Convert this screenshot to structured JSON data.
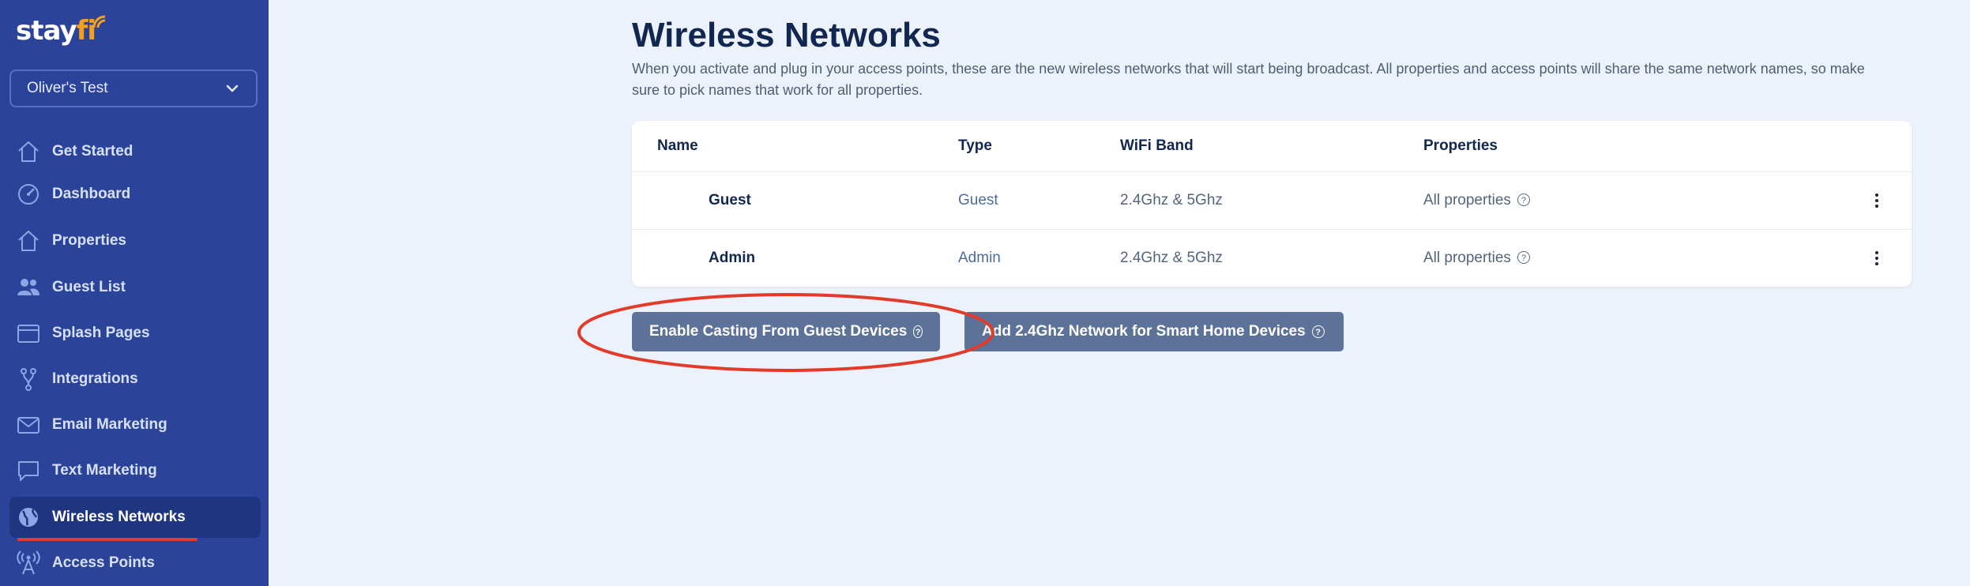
{
  "app": {
    "logo_text": "stay",
    "logo_accent": "fi"
  },
  "account": {
    "name": "Oliver's Test"
  },
  "sidebar": {
    "items": [
      {
        "label": "Get Started",
        "icon": "home-icon"
      },
      {
        "label": "Dashboard",
        "icon": "gauge-icon"
      },
      {
        "label": "Properties",
        "icon": "house-icon"
      },
      {
        "label": "Guest List",
        "icon": "users-icon"
      },
      {
        "label": "Splash Pages",
        "icon": "browser-window-icon"
      },
      {
        "label": "Integrations",
        "icon": "fork-icon"
      },
      {
        "label": "Email Marketing",
        "icon": "envelope-icon"
      },
      {
        "label": "Text Marketing",
        "icon": "chat-bubble-icon"
      },
      {
        "label": "Wireless Networks",
        "icon": "globe-icon",
        "active": true
      },
      {
        "label": "Access Points",
        "icon": "antenna-icon"
      }
    ]
  },
  "page": {
    "title": "Wireless Networks",
    "description": "When you activate and plug in your access points, these are the new wireless networks that will start being broadcast. All properties and access points will share the same network names, so make sure to pick names that work for all properties."
  },
  "table": {
    "headers": {
      "name": "Name",
      "type": "Type",
      "band": "WiFi Band",
      "properties": "Properties"
    },
    "rows": [
      {
        "name": "Guest",
        "type": "Guest",
        "band": "2.4Ghz & 5Ghz",
        "properties": "All properties"
      },
      {
        "name": "Admin",
        "type": "Admin",
        "band": "2.4Ghz & 5Ghz",
        "properties": "All properties"
      }
    ]
  },
  "actions": {
    "enable_casting": "Enable Casting From Guest Devices",
    "add_network": "Add 2.4Ghz Network for Smart Home Devices"
  },
  "help_glyph": "?",
  "colors": {
    "sidebar": "#2b449a",
    "active": "#1f3580",
    "button": "#5d7298",
    "annotation": "#e23b2a",
    "logo_accent": "#f4a01e"
  }
}
